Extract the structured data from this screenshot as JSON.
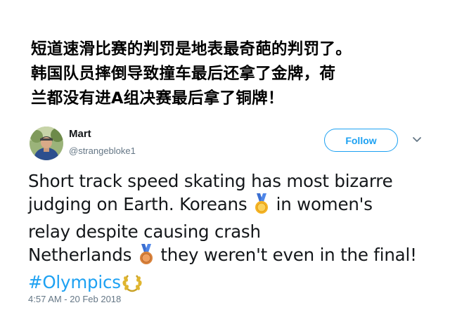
{
  "caption": {
    "text": "短道速滑比赛的判罚是地表最奇葩的判罚了。\n韩国队员摔倒导致撞车最后还拿了金牌，荷\n兰都没有进A组决赛最后拿了铜牌！"
  },
  "tweet": {
    "display_name": "Mart",
    "handle": "@strangebloke1",
    "follow_label": "Follow",
    "text": {
      "line1": "Short track speed skating has most bizarre",
      "line2_a": "judging on Earth. Koreans",
      "line2_b": "in women's",
      "line3": "relay despite causing crash",
      "line4_a": "Netherlands",
      "line4_b": "they weren't even in the final!",
      "hashtag": "#Olympics"
    },
    "icons": {
      "gold_medal": "gold-medal-icon",
      "bronze_medal": "bronze-medal-icon",
      "laurel": "laurel-wreath-icon",
      "chevron": "chevron-down-icon"
    },
    "timestamp": "4:57 AM - 20 Feb 2018"
  },
  "colors": {
    "accent": "#1da1f2",
    "text": "#14171a",
    "secondary": "#657786",
    "gold": "#f5b324",
    "bronze": "#d9823b"
  }
}
